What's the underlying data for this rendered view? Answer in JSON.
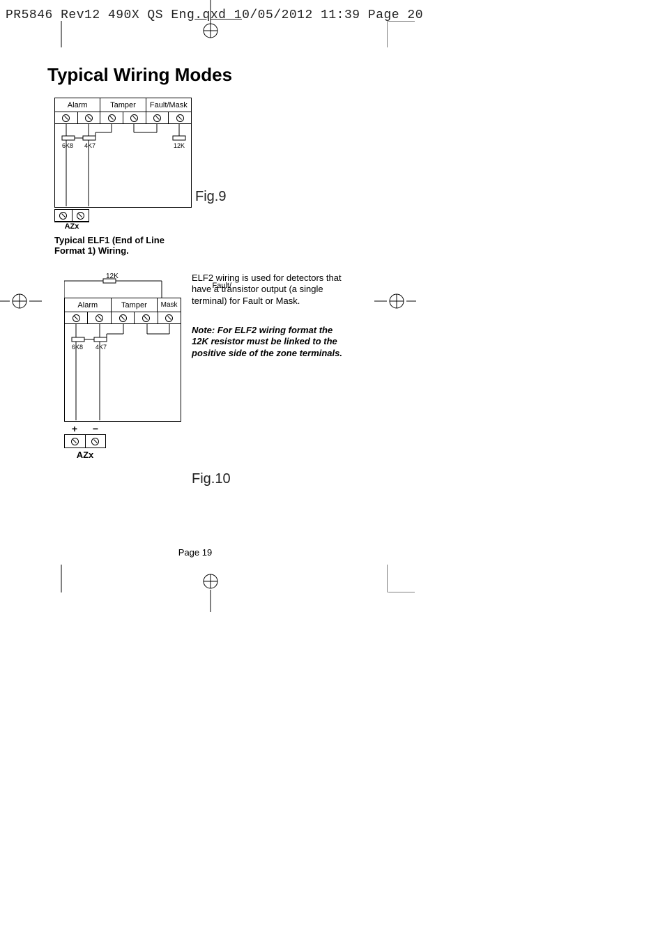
{
  "header": {
    "text_a": "PR5846 Rev12 490X QS Eng",
    "text_b": ".qxd  1",
    "text_c": "0/05/2012  11:39  Page 20"
  },
  "heading": "Typical Wiring Modes",
  "fig1": {
    "labels": {
      "alarm": "Alarm",
      "tamper": "Tamper",
      "faultmask": "Fault/Mask"
    },
    "resistors": {
      "r1": "6K8",
      "r2": "4K7",
      "r3": "12K"
    },
    "azx": "AZx",
    "fig_label": "Fig.9",
    "caption": "Typical ELF1 (End of Line Format 1) Wiring."
  },
  "fig2": {
    "top_res": "12K",
    "labels": {
      "alarm": "Alarm",
      "tamper": "Tamper",
      "faultmask_a": "Fault/",
      "faultmask_b": "Mask"
    },
    "resistors": {
      "r1": "6K8",
      "r2": "4K7"
    },
    "plus": "+",
    "minus": "−",
    "azx": "AZx",
    "fig_label": "Fig.10"
  },
  "para": "ELF2 wiring is used for detectors that have a transistor output (a single terminal) for Fault or Mask.",
  "note": "Note: For ELF2 wiring format the 12K resistor must be linked to the positive side of the zone terminals.",
  "page": "Page 19"
}
